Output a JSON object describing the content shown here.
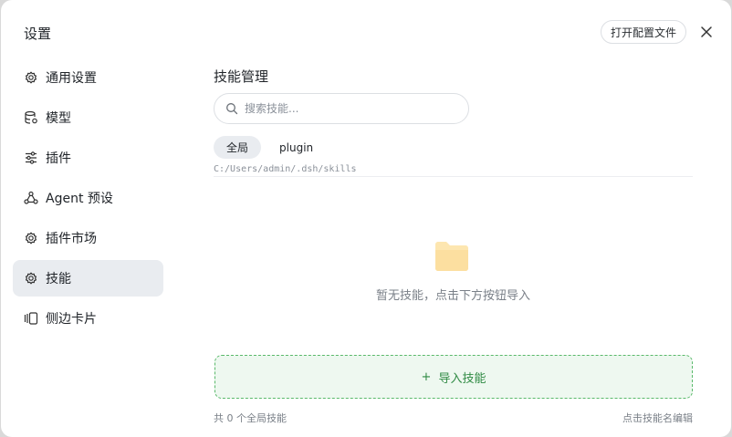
{
  "dialog": {
    "title": "设置",
    "open_config_label": "打开配置文件"
  },
  "sidebar": {
    "items": [
      {
        "label": "通用设置",
        "icon": "gear-icon"
      },
      {
        "label": "模型",
        "icon": "database-icon"
      },
      {
        "label": "插件",
        "icon": "sliders-icon"
      },
      {
        "label": "Agent 预设",
        "icon": "agent-icon"
      },
      {
        "label": "插件市场",
        "icon": "gear-icon"
      },
      {
        "label": "技能",
        "icon": "gear-icon",
        "active": true
      },
      {
        "label": "侧边卡片",
        "icon": "cards-icon"
      }
    ]
  },
  "main": {
    "section_title": "技能管理",
    "search": {
      "placeholder": "搜索技能..."
    },
    "tabs": [
      {
        "label": "全局",
        "active": true
      },
      {
        "label": "plugin"
      }
    ],
    "path": "C:/Users/admin/.dsh/skills",
    "empty_text": "暂无技能，点击下方按钮导入",
    "import_label": "导入技能",
    "footer_left": "共 0 个全局技能",
    "footer_right": "点击技能名编辑"
  },
  "colors": {
    "accent_green": "#2f8a43",
    "import_bg": "#eef8f0",
    "folder": "#fde6b0",
    "active_bg": "#e9ecf0"
  }
}
